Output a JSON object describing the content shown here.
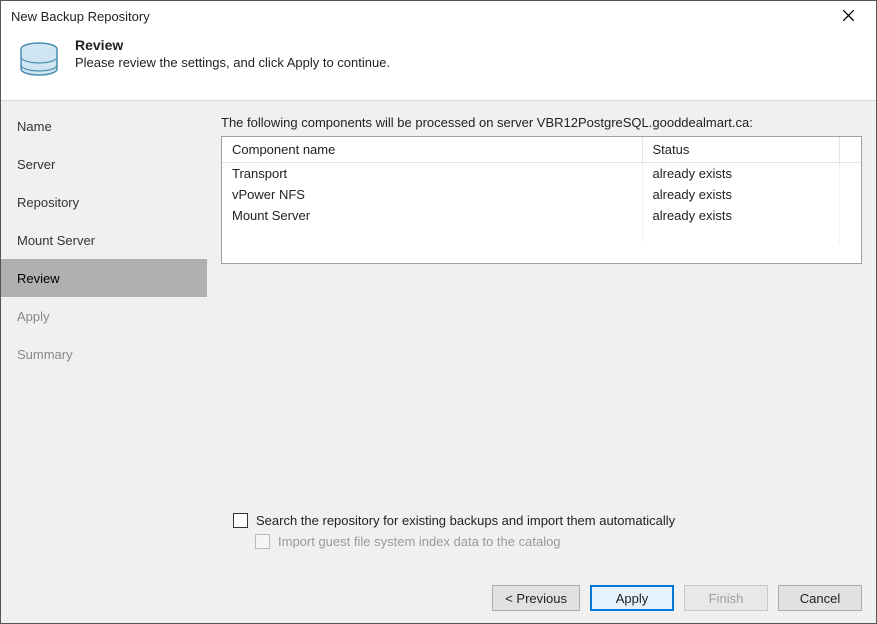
{
  "window_title": "New Backup Repository",
  "header": {
    "title": "Review",
    "subtitle": "Please review the settings, and click Apply to continue."
  },
  "sidebar": {
    "items": [
      {
        "label": "Name"
      },
      {
        "label": "Server"
      },
      {
        "label": "Repository"
      },
      {
        "label": "Mount Server"
      },
      {
        "label": "Review"
      },
      {
        "label": "Apply"
      },
      {
        "label": "Summary"
      }
    ]
  },
  "main": {
    "intro": "The following components will be processed on server VBR12PostgreSQL.gooddealmart.ca:",
    "columns": {
      "name": "Component name",
      "status": "Status"
    },
    "rows": [
      {
        "name": "Transport",
        "status": "already exists"
      },
      {
        "name": "vPower NFS",
        "status": "already exists"
      },
      {
        "name": "Mount Server",
        "status": "already exists"
      }
    ],
    "checks": {
      "search": "Search the repository for existing backups and import them automatically",
      "import_guest": "Import guest file system index data to the catalog"
    }
  },
  "footer": {
    "previous": "< Previous",
    "apply": "Apply",
    "finish": "Finish",
    "cancel": "Cancel"
  }
}
